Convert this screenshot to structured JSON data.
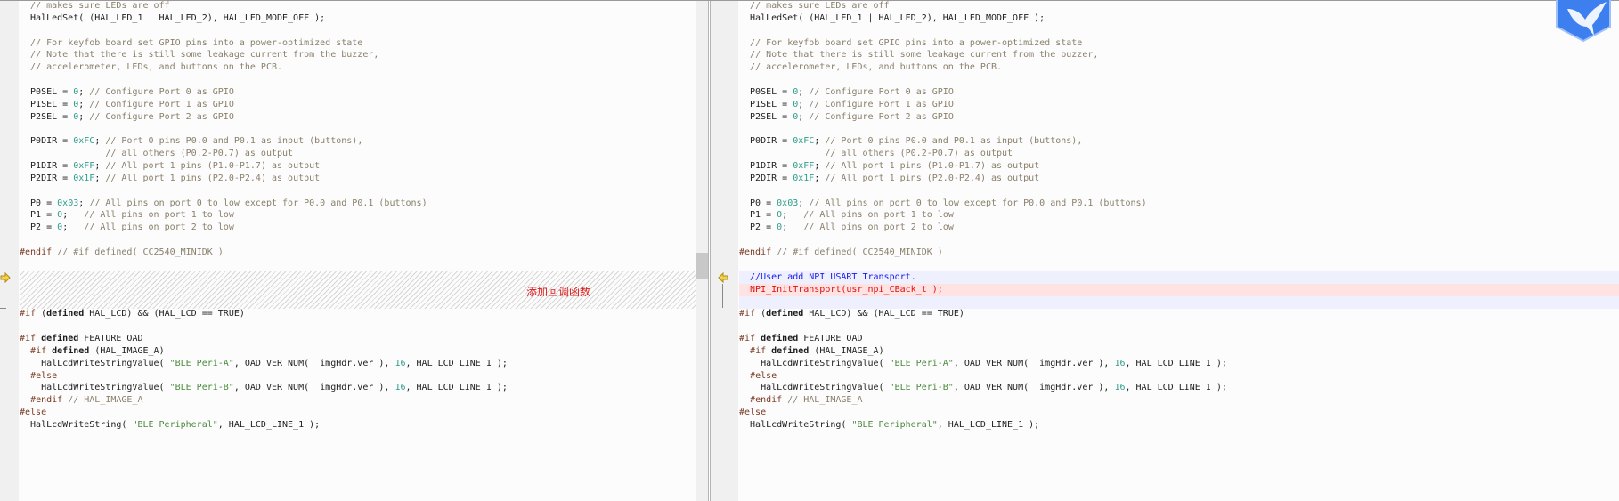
{
  "code": {
    "top": [
      [
        [
          "t",
          "  "
        ],
        [
          "c",
          "// makes sure LEDs are off"
        ]
      ],
      [
        [
          "t",
          "  HalLedSet( (HAL_LED_1 | HAL_LED_2), HAL_LED_MODE_OFF );"
        ]
      ],
      [],
      [
        [
          "t",
          "  "
        ],
        [
          "c",
          "// For keyfob board set GPIO pins into a power-optimized state"
        ]
      ],
      [
        [
          "t",
          "  "
        ],
        [
          "c",
          "// Note that there is still some leakage current from the buzzer,"
        ]
      ],
      [
        [
          "t",
          "  "
        ],
        [
          "c",
          "// accelerometer, LEDs, and buttons on the PCB."
        ]
      ],
      [],
      [
        [
          "t",
          "  P0SEL = "
        ],
        [
          "n",
          "0"
        ],
        [
          "t",
          "; "
        ],
        [
          "c",
          "// Configure Port 0 as GPIO"
        ]
      ],
      [
        [
          "t",
          "  P1SEL = "
        ],
        [
          "n",
          "0"
        ],
        [
          "t",
          "; "
        ],
        [
          "c",
          "// Configure Port 1 as GPIO"
        ]
      ],
      [
        [
          "t",
          "  P2SEL = "
        ],
        [
          "n",
          "0"
        ],
        [
          "t",
          "; "
        ],
        [
          "c",
          "// Configure Port 2 as GPIO"
        ]
      ],
      [],
      [
        [
          "t",
          "  P0DIR = "
        ],
        [
          "n",
          "0xFC"
        ],
        [
          "t",
          "; "
        ],
        [
          "c",
          "// Port 0 pins P0.0 and P0.1 as input (buttons),"
        ]
      ],
      [
        [
          "t",
          "                "
        ],
        [
          "c",
          "// all others (P0.2-P0.7) as output"
        ]
      ],
      [
        [
          "t",
          "  P1DIR = "
        ],
        [
          "n",
          "0xFF"
        ],
        [
          "t",
          "; "
        ],
        [
          "c",
          "// All port 1 pins (P1.0-P1.7) as output"
        ]
      ],
      [
        [
          "t",
          "  P2DIR = "
        ],
        [
          "n",
          "0x1F"
        ],
        [
          "t",
          "; "
        ],
        [
          "c",
          "// All port 1 pins (P2.0-P2.4) as output"
        ]
      ],
      [],
      [
        [
          "t",
          "  P0 = "
        ],
        [
          "n",
          "0x03"
        ],
        [
          "t",
          "; "
        ],
        [
          "c",
          "// All pins on port 0 to low except for P0.0 and P0.1 (buttons)"
        ]
      ],
      [
        [
          "t",
          "  P1 = "
        ],
        [
          "n",
          "0"
        ],
        [
          "t",
          ";   "
        ],
        [
          "c",
          "// All pins on port 1 to low"
        ]
      ],
      [
        [
          "t",
          "  P2 = "
        ],
        [
          "n",
          "0"
        ],
        [
          "t",
          ";   "
        ],
        [
          "c",
          "// All pins on port 2 to low"
        ]
      ],
      [],
      [
        [
          "p",
          "#endif"
        ],
        [
          "t",
          " "
        ],
        [
          "c",
          "// #if defined( CC2540_MINIDK )"
        ]
      ],
      []
    ],
    "bottom": [
      [
        [
          "p",
          "#if"
        ],
        [
          "t",
          " ("
        ],
        [
          "k",
          "defined"
        ],
        [
          "t",
          " HAL_LCD) && (HAL_LCD == TRUE)"
        ]
      ],
      [],
      [
        [
          "p",
          "#if"
        ],
        [
          "t",
          " "
        ],
        [
          "k",
          "defined"
        ],
        [
          "t",
          " FEATURE_OAD"
        ]
      ],
      [
        [
          "t",
          "  "
        ],
        [
          "p",
          "#if"
        ],
        [
          "t",
          " "
        ],
        [
          "k",
          "defined"
        ],
        [
          "t",
          " (HAL_IMAGE_A)"
        ]
      ],
      [
        [
          "t",
          "    HalLcdWriteStringValue( "
        ],
        [
          "s",
          "\"BLE Peri-A\""
        ],
        [
          "t",
          ", OAD_VER_NUM( _imgHdr.ver ), "
        ],
        [
          "n",
          "16"
        ],
        [
          "t",
          ", HAL_LCD_LINE_1 );"
        ]
      ],
      [
        [
          "t",
          "  "
        ],
        [
          "p",
          "#else"
        ]
      ],
      [
        [
          "t",
          "    HalLcdWriteStringValue( "
        ],
        [
          "s",
          "\"BLE Peri-B\""
        ],
        [
          "t",
          ", OAD_VER_NUM( _imgHdr.ver ), "
        ],
        [
          "n",
          "16"
        ],
        [
          "t",
          ", HAL_LCD_LINE_1 );"
        ]
      ],
      [
        [
          "t",
          "  "
        ],
        [
          "p",
          "#endif"
        ],
        [
          "t",
          " "
        ],
        [
          "c",
          "// HAL_IMAGE_A"
        ]
      ],
      [
        [
          "p",
          "#else"
        ]
      ],
      [
        [
          "t",
          "  HalLcdWriteString( "
        ],
        [
          "s",
          "\"BLE Peripheral\""
        ],
        [
          "t",
          ", HAL_LCD_LINE_1 );"
        ]
      ]
    ]
  },
  "right_inserted": [
    [
      [
        "bc",
        "  //User add NPI USART Transport."
      ]
    ],
    [
      [
        "rc",
        "  NPI_InitTransport(usr_npi_CBack_t );"
      ]
    ],
    []
  ],
  "left_annotation": "添加回调函数",
  "icons": {
    "left_marker": "arrow-right-icon",
    "right_marker": "arrow-left-icon",
    "logo": "bird-logo"
  },
  "colors": {
    "inserted_band": "#eef0fd",
    "changed_line": "#ffe2e2",
    "annotation": "#e01818"
  }
}
